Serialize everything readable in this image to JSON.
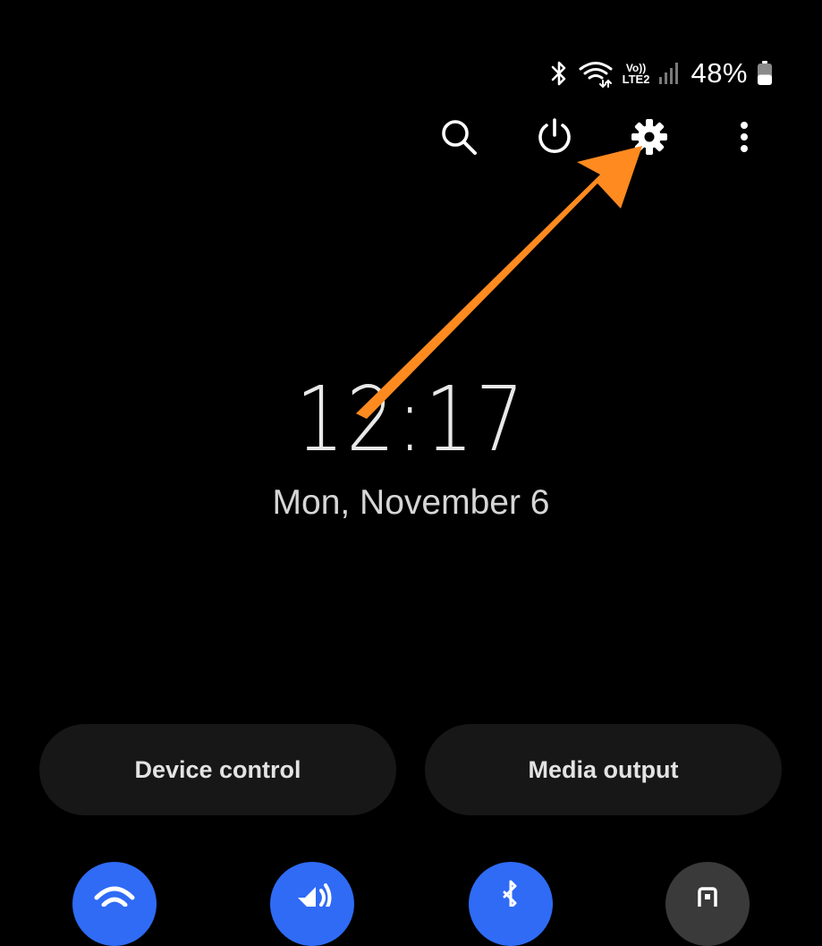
{
  "status_bar": {
    "battery_percent": "48%",
    "volte_label": "Vo))",
    "lte_label": "LTE2",
    "icons": [
      "bluetooth-icon",
      "wifi-icon",
      "volte-lte-icon",
      "signal-icon",
      "battery-icon"
    ],
    "battery_level": 0.48
  },
  "qs_actions": {
    "icons": [
      "search-icon",
      "power-icon",
      "gear-icon",
      "more-vertical-icon"
    ]
  },
  "clock": {
    "time": "12:17",
    "date": "Mon, November 6"
  },
  "pills": {
    "device_control": "Device control",
    "media_output": "Media output"
  },
  "toggles": {
    "icons": [
      "wifi-icon",
      "sound-icon",
      "bluetooth-icon",
      "lock-rotation-icon"
    ],
    "states": [
      true,
      true,
      true,
      false
    ]
  },
  "colors": {
    "background": "#000000",
    "accent_blue": "#2f6bf5",
    "inactive_gray": "#3a3a3a",
    "pill_bg": "#171717",
    "annotation_orange": "#ff8a1f"
  }
}
